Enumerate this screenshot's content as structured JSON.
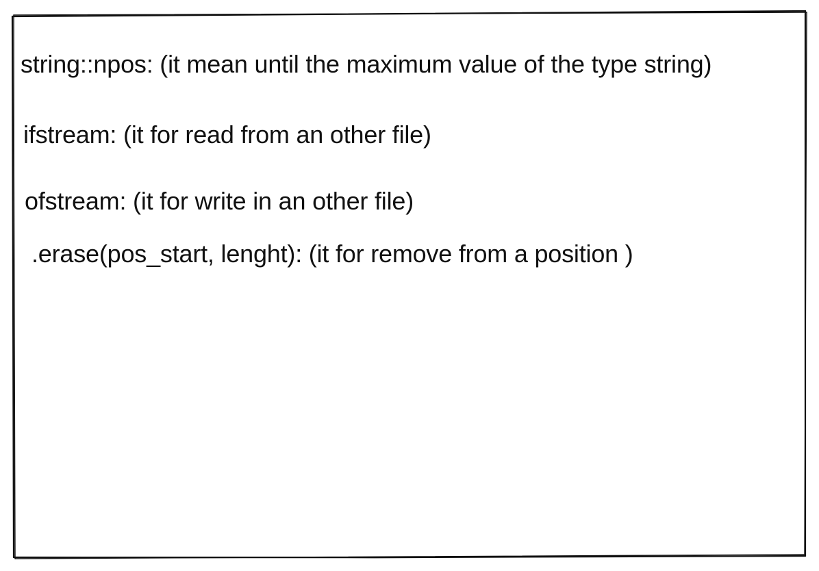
{
  "notes": [
    {
      "text": "string::npos: (it mean until the maximum value of the type string)"
    },
    {
      "text": "ifstream: (it for read from an other file)"
    },
    {
      "text": "ofstream: (it for write in an other file)"
    },
    {
      "text": ".erase(pos_start, lenght): (it for remove from a position )"
    }
  ],
  "colors": {
    "stroke": "#111111",
    "background": "#ffffff"
  }
}
